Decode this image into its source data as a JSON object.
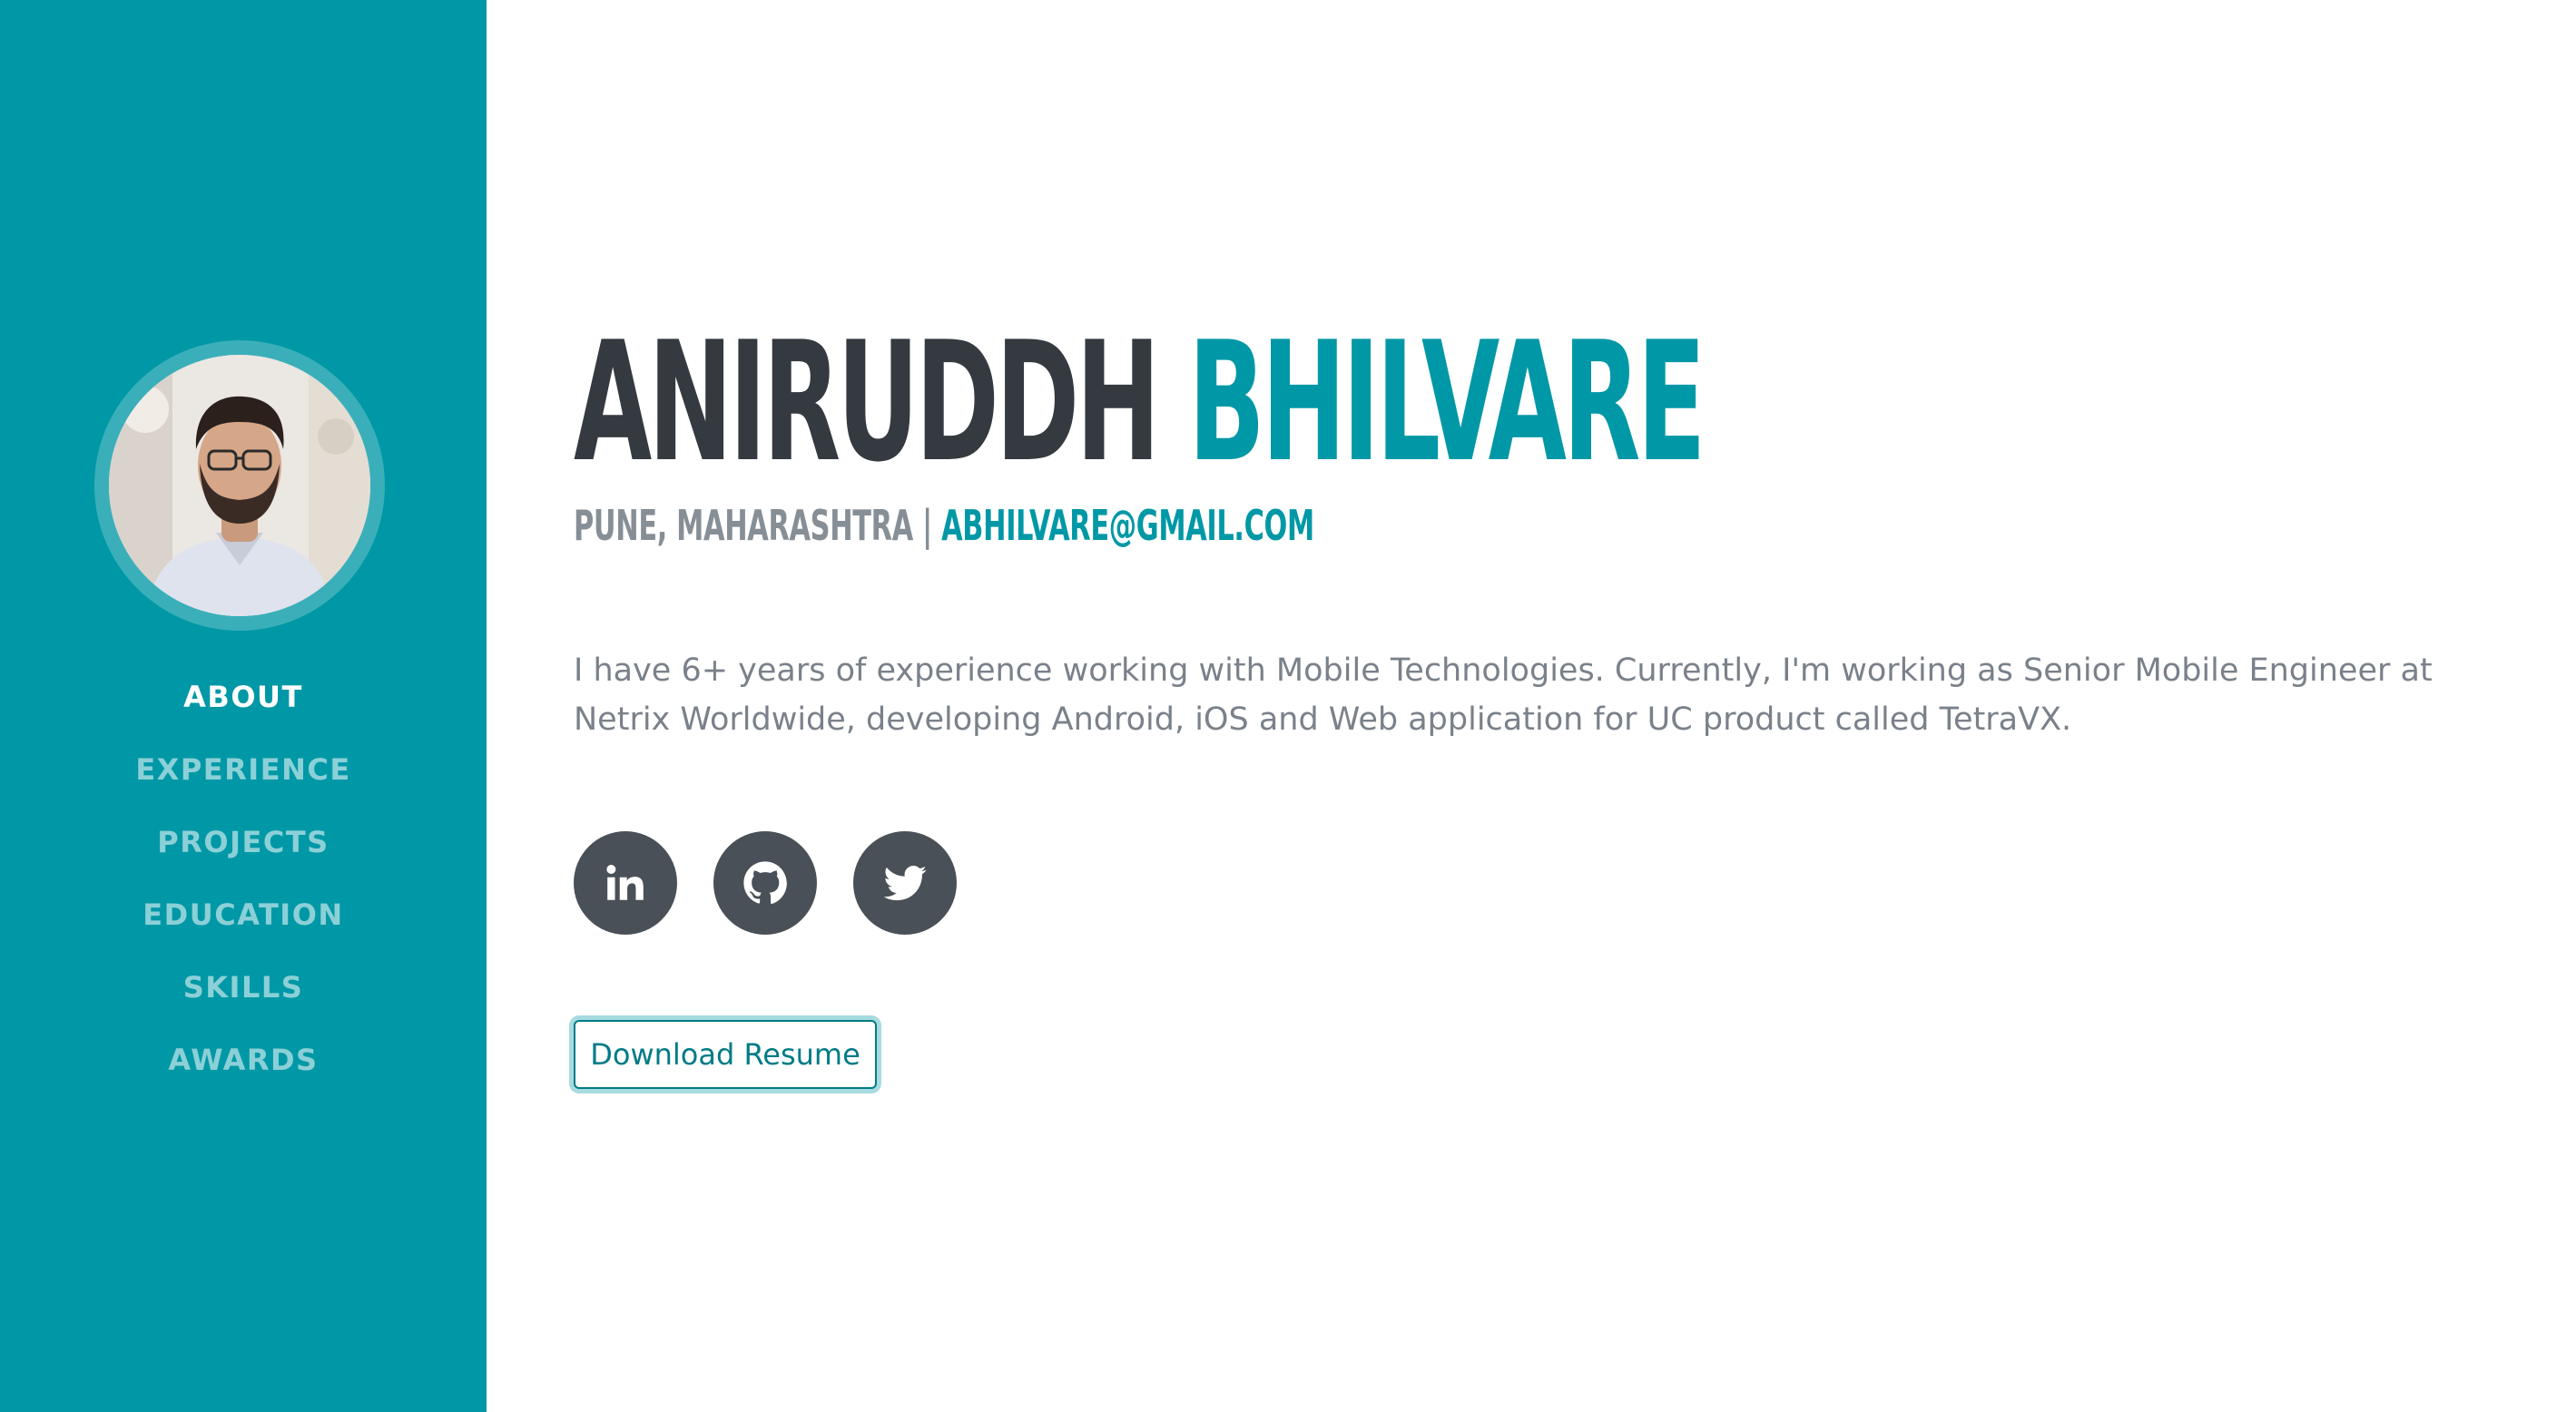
{
  "profile": {
    "first_name": "ANIRUDDH",
    "last_name": "BHILVARE",
    "location": "PUNE, MAHARASHTRA",
    "separator": " | ",
    "email": "ABHILVARE@GMAIL.COM",
    "bio": "I have 6+ years of experience working with Mobile Technologies. Currently, I'm working as Senior Mobile Engineer at Netrix Worldwide, developing Android, iOS and Web application for UC product called TetraVX."
  },
  "nav": {
    "items": [
      {
        "label": "ABOUT",
        "active": true
      },
      {
        "label": "EXPERIENCE",
        "active": false
      },
      {
        "label": "PROJECTS",
        "active": false
      },
      {
        "label": "EDUCATION",
        "active": false
      },
      {
        "label": "SKILLS",
        "active": false
      },
      {
        "label": "AWARDS",
        "active": false
      }
    ]
  },
  "social": {
    "icons": [
      "linkedin-icon",
      "github-icon",
      "twitter-icon"
    ]
  },
  "actions": {
    "download_resume": "Download Resume"
  },
  "colors": {
    "primary": "#0098a6",
    "dark_text": "#343a40",
    "muted_text": "#868e96",
    "social_bg": "#495057"
  }
}
